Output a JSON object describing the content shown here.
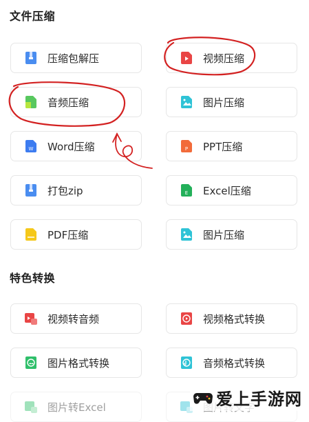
{
  "sections": {
    "compress_title": "文件压缩",
    "feature_title": "特色转换"
  },
  "compress_items": [
    {
      "label": "压缩包解压",
      "icon": "archive-icon",
      "color": "#4a8df0"
    },
    {
      "label": "视频压缩",
      "icon": "video-file-icon",
      "color": "#e94545"
    },
    {
      "label": "音频压缩",
      "icon": "audio-file-icon",
      "color": "#58c85f"
    },
    {
      "label": "图片压缩",
      "icon": "image-file-icon",
      "color": "#2fc3d6"
    },
    {
      "label": "Word压缩",
      "icon": "word-file-icon",
      "color": "#3d7cf0"
    },
    {
      "label": "PPT压缩",
      "icon": "ppt-file-icon",
      "color": "#f26b3a"
    },
    {
      "label": "打包zip",
      "icon": "zip-icon",
      "color": "#4a8df0"
    },
    {
      "label": "Excel压缩",
      "icon": "excel-file-icon",
      "color": "#23b05a"
    },
    {
      "label": "PDF压缩",
      "icon": "pdf-file-icon",
      "color": "#f5c81a"
    },
    {
      "label": "图片压缩",
      "icon": "image-file-icon",
      "color": "#2fc3d6"
    }
  ],
  "feature_items": [
    {
      "label": "视频转音频",
      "icon": "video-to-audio-icon",
      "color": "#e94545"
    },
    {
      "label": "视频格式转换",
      "icon": "video-convert-icon",
      "color": "#e94545"
    },
    {
      "label": "图片格式转换",
      "icon": "image-convert-icon",
      "color": "#2fbf6a"
    },
    {
      "label": "音频格式转换",
      "icon": "audio-convert-icon",
      "color": "#2fc3d6"
    },
    {
      "label": "图片转Excel",
      "icon": "image-to-excel-icon",
      "color": "#2fbf6a"
    },
    {
      "label": "图片转文字",
      "icon": "image-to-text-icon",
      "color": "#2fc3d6"
    }
  ],
  "watermark": {
    "text": "爱上手游网"
  },
  "colors": {
    "annotation_red": "#d32121",
    "card_border": "#e6e6e6"
  }
}
